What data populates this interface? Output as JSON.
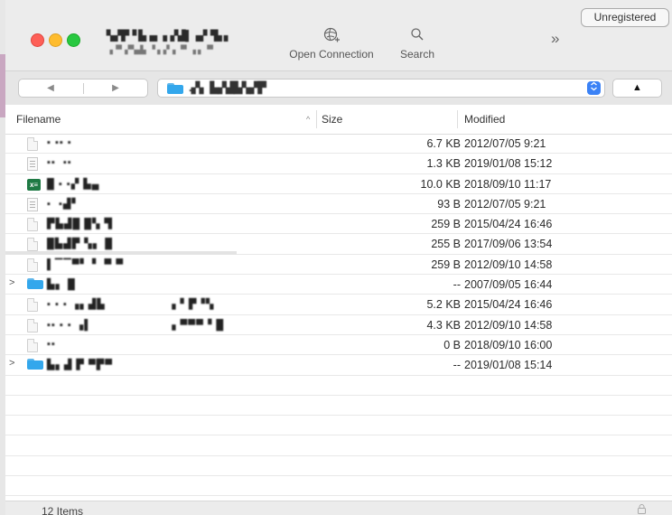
{
  "titlebar": {
    "server_name": "▚▞▛▝ ▙▗▖ ▖▞▟▌▗▞▝▙ ▖",
    "server_sub": "▗▝▘▞▚▟▖▝ ▖▞▗ ▝▘▗ ▖▝▘"
  },
  "toolbar": {
    "open_connection_label": "Open Connection",
    "open_connection_icon": "globe-plus-icon",
    "search_label": "Search",
    "search_icon": "magnifier-icon",
    "overflow_icon": "»",
    "unregistered_label": "Unregistered"
  },
  "navbar": {
    "back_icon": "◀",
    "forward_icon": "▶",
    "path": ".▞▖ ▙▞▟▙▚▞▛",
    "path_toggle_icon": "⌃⌄",
    "up_icon": "▲"
  },
  "columns": {
    "filename": "Filename",
    "sort_indicator": "^",
    "size": "Size",
    "modified": "Modified"
  },
  "files": [
    {
      "type": "doc",
      "expandable": false,
      "name": "▪ ▪▪ ▪",
      "name2": "",
      "size": "6.7 KB",
      "modified": "2012/07/05 9:21"
    },
    {
      "type": "txt",
      "expandable": false,
      "name": "▪▪  ▪▪",
      "name2": "",
      "size": "1.3 KB",
      "modified": "2019/01/08 15:12"
    },
    {
      "type": "xls",
      "expandable": false,
      "name": "█ ▪ ▪▞ ▙▄",
      "name2": "",
      "size": "10.0 KB",
      "modified": "2018/09/10 11:17"
    },
    {
      "type": "txt",
      "expandable": false,
      "name": "▪  ▪▟▘",
      "name2": "",
      "size": "93 B",
      "modified": "2012/07/05 9:21"
    },
    {
      "type": "doc",
      "expandable": false,
      "name": "▛▙▟█ █▚ ▜",
      "name2": "",
      "size": "259 B",
      "modified": "2015/04/24 16:46"
    },
    {
      "type": "doc",
      "expandable": false,
      "name": "█▙▟▛ ▚▖ █",
      "name2": "",
      "size": "255 B",
      "modified": "2017/09/06 13:54"
    },
    {
      "type": "doc",
      "expandable": false,
      "name": "▌▔▔▀▘ ▘ ▀ ▀",
      "name2": "",
      "size": "259 B",
      "modified": "2012/09/10 14:58"
    },
    {
      "type": "folder",
      "expandable": true,
      "name": "▙▖ █",
      "name2": "",
      "size": "--",
      "modified": "2007/09/05 16:44"
    },
    {
      "type": "doc",
      "expandable": false,
      "name": "▪ ▪ ▪ ▗▖▟▙",
      "name2": "▗ ▘▛▝▚",
      "size": "5.2 KB",
      "modified": "2015/04/24 16:46"
    },
    {
      "type": "doc",
      "expandable": false,
      "name": "▪▪ ▪ ▪ ▗▌",
      "name2": "▗ ▀▀▀▝ █",
      "size": "4.3 KB",
      "modified": "2012/09/10 14:58"
    },
    {
      "type": "doc",
      "expandable": false,
      "name": "▪▪",
      "name2": "",
      "size": "0 B",
      "modified": "2018/09/10 16:00"
    },
    {
      "type": "folder",
      "expandable": true,
      "name": "▙▖▟ ▛ ▀▛▀",
      "name2": "",
      "size": "--",
      "modified": "2019/01/08 15:14"
    }
  ],
  "status": {
    "item_count": "12 Items",
    "lock_icon": "padlock-icon"
  },
  "colors": {
    "accent_blue": "#3b82f6",
    "folder_blue": "#33a7ec",
    "close_red": "#fe5f57",
    "minimize_yellow": "#febc2e",
    "zoom_green": "#28c840",
    "excel_green": "#1f7a44"
  }
}
